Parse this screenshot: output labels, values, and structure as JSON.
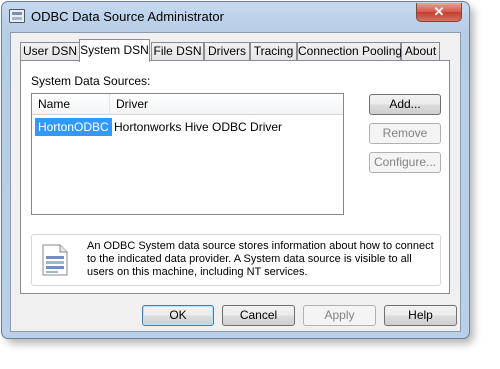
{
  "window": {
    "title": "ODBC Data Source Administrator",
    "close_glyph": "✕"
  },
  "tabs": [
    {
      "label": "User DSN",
      "active": false
    },
    {
      "label": "System DSN",
      "active": true
    },
    {
      "label": "File DSN",
      "active": false
    },
    {
      "label": "Drivers",
      "active": false
    },
    {
      "label": "Tracing",
      "active": false
    },
    {
      "label": "Connection Pooling",
      "active": false
    },
    {
      "label": "About",
      "active": false
    }
  ],
  "system_dsn": {
    "section_label": "System Data Sources:",
    "columns": [
      "Name",
      "Driver"
    ],
    "rows": [
      {
        "name": "HortonODBC",
        "driver": "Hortonworks Hive ODBC Driver",
        "selected": true
      }
    ],
    "buttons": {
      "add": "Add...",
      "remove": "Remove",
      "configure": "Configure..."
    },
    "info_text": "An ODBC System data source stores information about how to connect to the indicated data provider.   A System data source is visible to all users on this machine, including NT services.",
    "info_icon": "data-source-info-icon"
  },
  "footer": {
    "ok": "OK",
    "cancel": "Cancel",
    "apply": "Apply",
    "help": "Help"
  },
  "colors": {
    "selection": "#3399ff",
    "title_gradient_top": "#c6d9ef",
    "close_button": "#d7554a"
  }
}
